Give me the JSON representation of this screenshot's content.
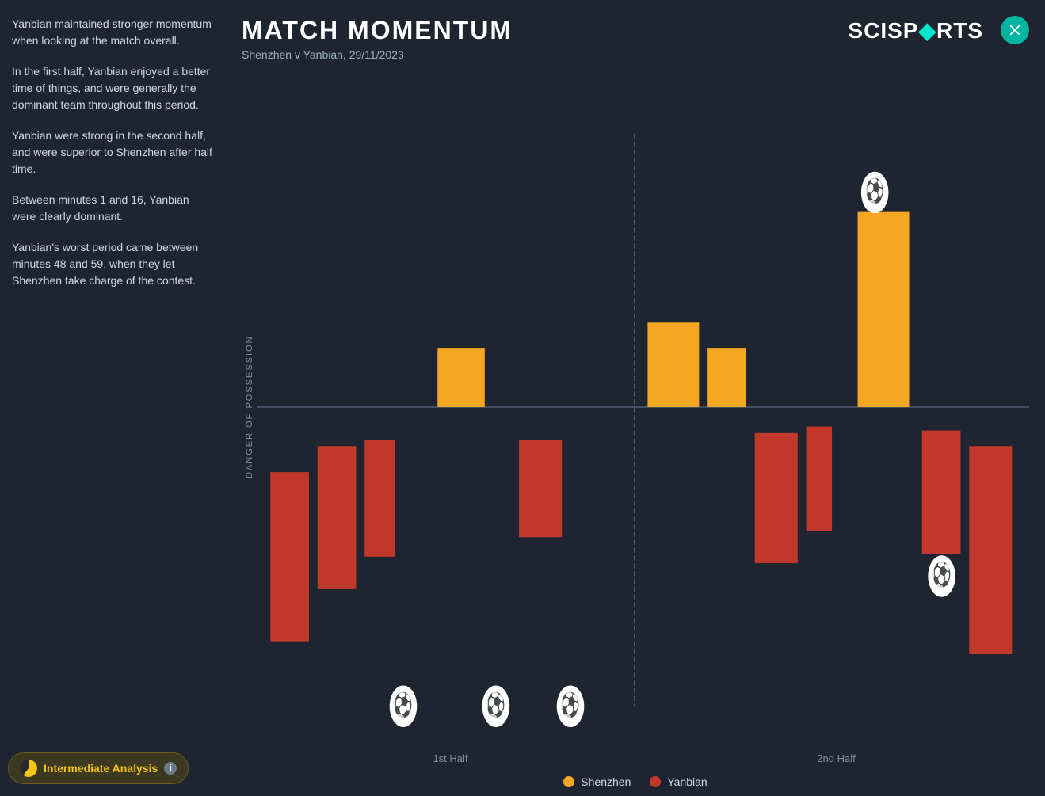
{
  "app": {
    "title": "MATCH MOMENTUM",
    "subtitle": "Shenzhen v Yanbian, 29/11/2023",
    "logo": "SCISPORTS",
    "close_label": "×"
  },
  "left_panel": {
    "paragraphs": [
      "Yanbian maintained stronger momentum when looking at the match overall.",
      "In the first half, Yanbian enjoyed a better time of things, and were generally the dominant team throughout this period.",
      "Yanbian were strong in the second half, and were superior to Shenzhen after half time.",
      "Between minutes 1 and 16, Yanbian were clearly dominant.",
      "Yanbian's worst period came between minutes 48 and 59, when they let Shenzhen take charge of the contest."
    ]
  },
  "chart": {
    "y_axis_label": "DANGER OF POSSESSION",
    "half_labels": [
      "1st Half",
      "2nd Half"
    ],
    "legend": [
      {
        "color": "#f5a623",
        "label": "Shenzhen"
      },
      {
        "color": "#c0392b",
        "label": "Yanbian"
      }
    ]
  },
  "bottom_bar": {
    "label": "Intermediate Analysis",
    "info": "i"
  },
  "colors": {
    "background": "#1e2530",
    "shenzhen": "#f5a623",
    "yanbian": "#c0392b",
    "accent": "#00e5cc",
    "text_primary": "#ffffff",
    "text_secondary": "#a0b0c0"
  }
}
